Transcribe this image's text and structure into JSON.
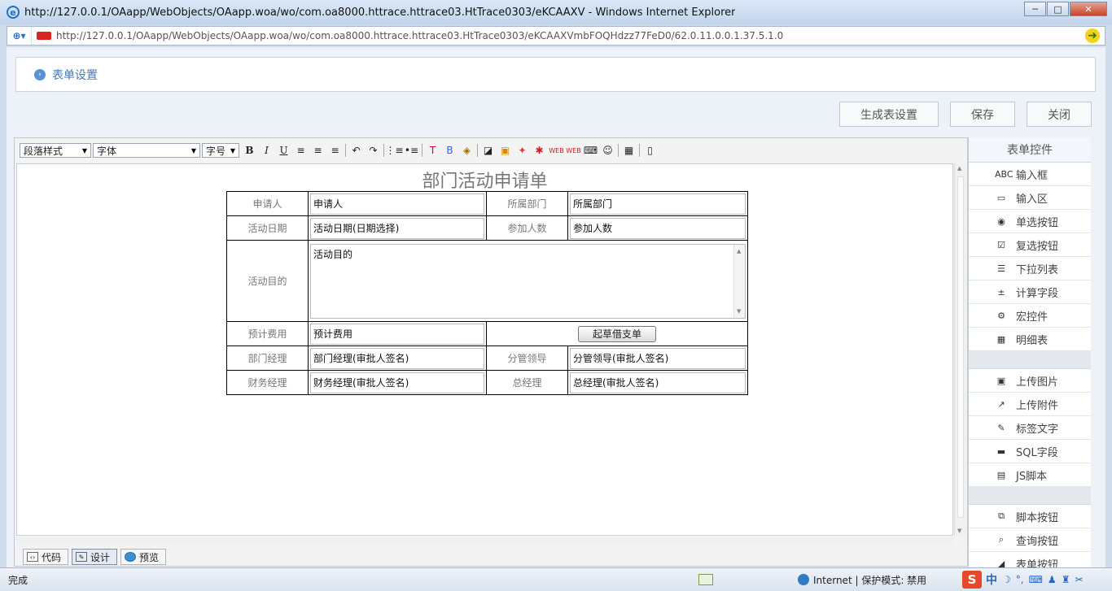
{
  "window": {
    "title": "http://127.0.0.1/OAapp/WebObjects/OAapp.woa/wo/com.oa8000.httrace.httrace03.HtTrace0303/eKCAAXV - Windows Internet Explorer",
    "url": "http://127.0.0.1/OAapp/WebObjects/OAapp.woa/wo/com.oa8000.httrace.httrace03.HtTrace0303/eKCAAXVmbFOQHdzz77FeD0/62.0.11.0.0.1.37.5.1.0",
    "minimize": "─",
    "maximize": "□",
    "close": "✕"
  },
  "breadcrumb": "表单设置",
  "actions": {
    "generate": "生成表设置",
    "save": "保存",
    "close": "关闭"
  },
  "toolbar": {
    "paragraph": "段落样式",
    "font": "字体",
    "size": "字号",
    "bold": "B",
    "italic": "I",
    "underline": "U"
  },
  "form": {
    "title": "部门活动申请单",
    "applicant_label": "申请人",
    "applicant_value": "申请人",
    "dept_label": "所属部门",
    "dept_value": "所属部门",
    "date_label": "活动日期",
    "date_value": "活动日期(日期选择)",
    "count_label": "参加人数",
    "count_value": "参加人数",
    "purpose_label": "活动目的",
    "purpose_value": "活动目的",
    "budget_label": "预计费用",
    "budget_value": "预计费用",
    "draft_button": "起草借支单",
    "manager_label": "部门经理",
    "manager_value": "部门经理(审批人签名)",
    "leader_label": "分管领导",
    "leader_value": "分管领导(审批人签名)",
    "finance_label": "财务经理",
    "finance_value": "财务经理(审批人签名)",
    "gm_label": "总经理",
    "gm_value": "总经理(审批人签名)"
  },
  "modes": {
    "code": "代码",
    "design": "设计",
    "preview": "预览"
  },
  "panel": {
    "title": "表单控件",
    "group1": [
      {
        "icon": "text-input-icon",
        "glyph": "ABC",
        "label": "输入框"
      },
      {
        "icon": "textarea-icon",
        "glyph": "▭",
        "label": "输入区"
      },
      {
        "icon": "radio-icon",
        "glyph": "◉",
        "label": "单选按钮"
      },
      {
        "icon": "checkbox-icon",
        "glyph": "☑",
        "label": "复选按钮"
      },
      {
        "icon": "list-icon",
        "glyph": "☰",
        "label": "下拉列表"
      },
      {
        "icon": "calc-icon",
        "glyph": "±",
        "label": "计算字段"
      },
      {
        "icon": "gear-icon",
        "glyph": "⚙",
        "label": "宏控件"
      },
      {
        "icon": "grid-icon",
        "glyph": "▦",
        "label": "明细表"
      }
    ],
    "group2": [
      {
        "icon": "image-icon",
        "glyph": "▣",
        "label": "上传图片"
      },
      {
        "icon": "attachment-icon",
        "glyph": "↗",
        "label": "上传附件"
      },
      {
        "icon": "wand-icon",
        "glyph": "✎",
        "label": "标签文字"
      },
      {
        "icon": "folder-icon",
        "glyph": "▬",
        "label": "SQL字段"
      },
      {
        "icon": "script-icon",
        "glyph": "▤",
        "label": "JS脚本"
      }
    ],
    "group3": [
      {
        "icon": "copy-icon",
        "glyph": "⧉",
        "label": "脚本按钮"
      },
      {
        "icon": "search-icon",
        "glyph": "⌕",
        "label": "查询按钮"
      },
      {
        "icon": "eraser-icon",
        "glyph": "◢",
        "label": "表单按钮"
      }
    ]
  },
  "status": {
    "done": "完成",
    "zone": "Internet | 保护模式: 禁用",
    "ime_logo": "S",
    "ime_lang": "中"
  }
}
